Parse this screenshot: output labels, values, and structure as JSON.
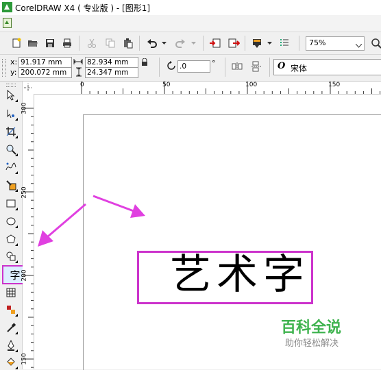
{
  "window": {
    "title": "CorelDRAW X4 ( 专业版 ) - [图形1]"
  },
  "toolbar": {
    "zoom": "75%"
  },
  "property_bar": {
    "x_label": "x:",
    "x_value": "91.917 mm",
    "y_label": "y:",
    "y_value": "200.072 mm",
    "width_value": "82.934 mm",
    "height_value": "24.347 mm",
    "angle_value": ".0",
    "angle_unit": "°",
    "font_name": "宋体"
  },
  "rulers": {
    "h_ticks": [
      "0",
      "50",
      "100",
      "150"
    ],
    "v_ticks": [
      "300",
      "250",
      "200",
      "150"
    ]
  },
  "canvas": {
    "art_text": "艺术字"
  },
  "watermark": {
    "title": "百科全说",
    "subtitle": "助你轻松解决"
  },
  "colors": {
    "highlight": "#cc33cc",
    "arrow": "#e040e0",
    "watermark": "#3fb34f"
  }
}
